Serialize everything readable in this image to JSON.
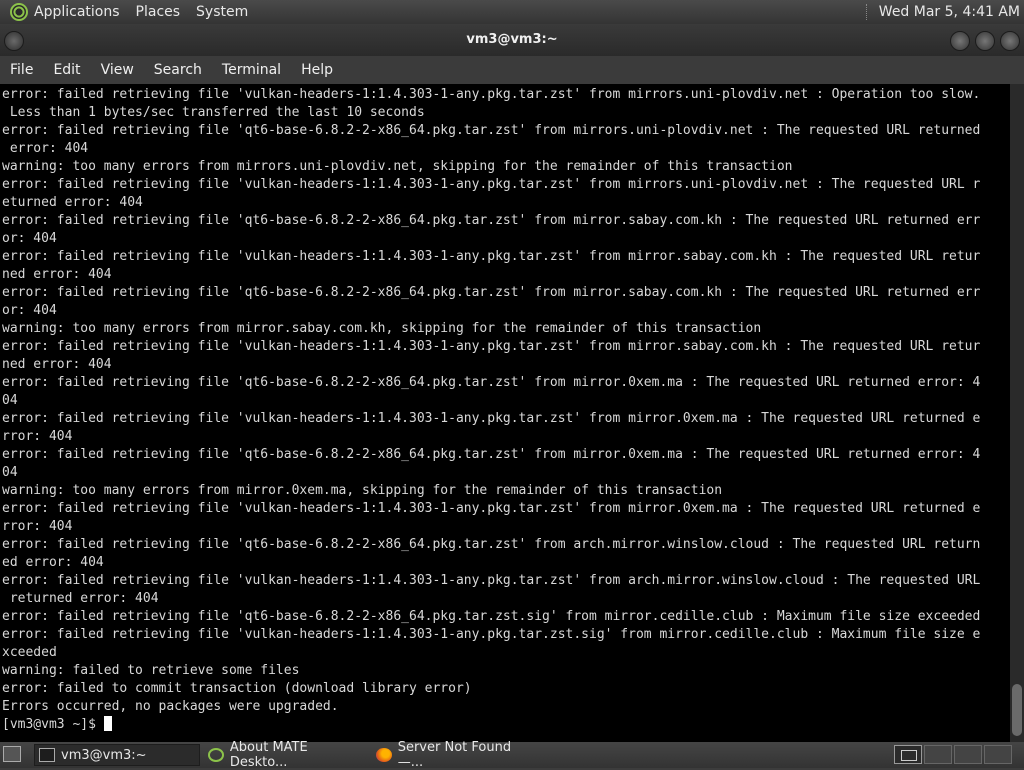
{
  "top_panel": {
    "menus": [
      "Applications",
      "Places",
      "System"
    ],
    "clock": "Wed Mar  5,  4:41 AM"
  },
  "window": {
    "title": "vm3@vm3:~",
    "menus": [
      "File",
      "Edit",
      "View",
      "Search",
      "Terminal",
      "Help"
    ]
  },
  "terminal": {
    "lines": [
      "error: failed retrieving file 'vulkan-headers-1:1.4.303-1-any.pkg.tar.zst' from mirrors.uni-plovdiv.net : Operation too slow.",
      " Less than 1 bytes/sec transferred the last 10 seconds",
      "error: failed retrieving file 'qt6-base-6.8.2-2-x86_64.pkg.tar.zst' from mirrors.uni-plovdiv.net : The requested URL returned",
      " error: 404",
      "warning: too many errors from mirrors.uni-plovdiv.net, skipping for the remainder of this transaction",
      "error: failed retrieving file 'vulkan-headers-1:1.4.303-1-any.pkg.tar.zst' from mirrors.uni-plovdiv.net : The requested URL r",
      "eturned error: 404",
      "error: failed retrieving file 'qt6-base-6.8.2-2-x86_64.pkg.tar.zst' from mirror.sabay.com.kh : The requested URL returned err",
      "or: 404",
      "error: failed retrieving file 'vulkan-headers-1:1.4.303-1-any.pkg.tar.zst' from mirror.sabay.com.kh : The requested URL retur",
      "ned error: 404",
      "error: failed retrieving file 'qt6-base-6.8.2-2-x86_64.pkg.tar.zst' from mirror.sabay.com.kh : The requested URL returned err",
      "or: 404",
      "warning: too many errors from mirror.sabay.com.kh, skipping for the remainder of this transaction",
      "error: failed retrieving file 'vulkan-headers-1:1.4.303-1-any.pkg.tar.zst' from mirror.sabay.com.kh : The requested URL retur",
      "ned error: 404",
      "error: failed retrieving file 'qt6-base-6.8.2-2-x86_64.pkg.tar.zst' from mirror.0xem.ma : The requested URL returned error: 4",
      "04",
      "error: failed retrieving file 'vulkan-headers-1:1.4.303-1-any.pkg.tar.zst' from mirror.0xem.ma : The requested URL returned e",
      "rror: 404",
      "error: failed retrieving file 'qt6-base-6.8.2-2-x86_64.pkg.tar.zst' from mirror.0xem.ma : The requested URL returned error: 4",
      "04",
      "warning: too many errors from mirror.0xem.ma, skipping for the remainder of this transaction",
      "error: failed retrieving file 'vulkan-headers-1:1.4.303-1-any.pkg.tar.zst' from mirror.0xem.ma : The requested URL returned e",
      "rror: 404",
      "error: failed retrieving file 'qt6-base-6.8.2-2-x86_64.pkg.tar.zst' from arch.mirror.winslow.cloud : The requested URL return",
      "ed error: 404",
      "error: failed retrieving file 'vulkan-headers-1:1.4.303-1-any.pkg.tar.zst' from arch.mirror.winslow.cloud : The requested URL",
      " returned error: 404",
      "error: failed retrieving file 'qt6-base-6.8.2-2-x86_64.pkg.tar.zst.sig' from mirror.cedille.club : Maximum file size exceeded",
      "error: failed retrieving file 'vulkan-headers-1:1.4.303-1-any.pkg.tar.zst.sig' from mirror.cedille.club : Maximum file size e",
      "xceeded",
      "warning: failed to retrieve some files",
      "error: failed to commit transaction (download library error)",
      "Errors occurred, no packages were upgraded."
    ],
    "prompt": "[vm3@vm3 ~]$ "
  },
  "taskbar": {
    "items": [
      {
        "label": "vm3@vm3:~",
        "icon": "terminal-icon",
        "active": true
      },
      {
        "label": "About MATE Deskto...",
        "icon": "mate-icon",
        "active": false
      },
      {
        "label": "Server Not Found —...",
        "icon": "firefox-icon",
        "active": false
      }
    ]
  }
}
